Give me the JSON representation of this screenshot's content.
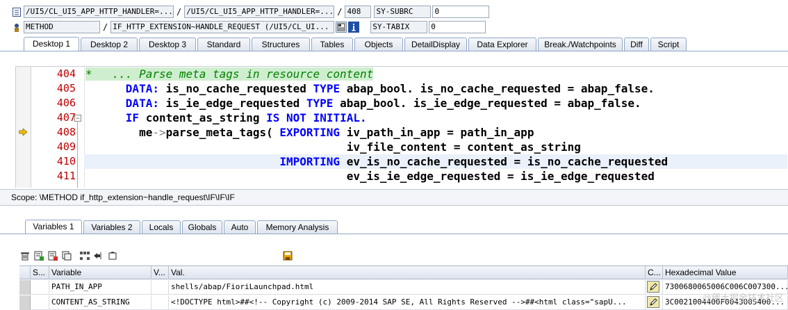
{
  "header": {
    "row1": {
      "program_1": "/UI5/CL_UI5_APP_HTTP_HANDLER=...",
      "program_2": "/UI5/CL_UI5_APP_HTTP_HANDLER=...",
      "line": "408",
      "sys_label": "SY-SUBRC",
      "sys_value": "0"
    },
    "row2": {
      "event_type": "METHOD",
      "event_name": "IF_HTTP_EXTENSION~HANDLE_REQUEST (/UI5/CL_UI...",
      "sys_label": "SY-TABIX",
      "sys_value": "0"
    },
    "icons": {
      "row1": "program-icon",
      "row2": "method-icon",
      "info": "info-icon",
      "doc": "document-icon"
    }
  },
  "desktop_tabs": [
    "Desktop 1",
    "Desktop 2",
    "Desktop 3",
    "Standard",
    "Structures",
    "Tables",
    "Objects",
    "DetailDisplay",
    "Data Explorer",
    "Break./Watchpoints",
    "Diff",
    "Script"
  ],
  "code": {
    "lines": [
      {
        "num": "404",
        "text": "*   ... Parse meta tags in resource content"
      },
      {
        "num": "405",
        "text": "DATA: is_no_cache_requested TYPE abap_bool. is_no_cache_requested = abap_false."
      },
      {
        "num": "406",
        "text": "DATA: is_ie_edge_requested TYPE abap_bool. is_ie_edge_requested = abap_false."
      },
      {
        "num": "407",
        "text": "IF content_as_string IS NOT INITIAL."
      },
      {
        "num": "408",
        "text": "me->parse_meta_tags( EXPORTING iv_path_in_app = path_in_app"
      },
      {
        "num": "409",
        "text": "iv_file_content = content_as_string"
      },
      {
        "num": "410",
        "text": "IMPORTING ev_is_no_cache_requested = is_no_cache_requested"
      },
      {
        "num": "411",
        "text": "ev_is_ie_edge_requested = is_ie_edge_requested"
      }
    ],
    "current_line": "408"
  },
  "scope": "Scope: \\METHOD if_http_extension~handle_request\\IF\\IF\\IF",
  "variable_tabs": [
    "Variables 1",
    "Variables 2",
    "Locals",
    "Globals",
    "Auto",
    "Memory Analysis"
  ],
  "toolbar_icons": [
    "delete-icon",
    "insert-icon",
    "append-icon",
    "copy-icon",
    "hierarchy-icon",
    "navigate-icon",
    "detail-icon",
    "save-icon"
  ],
  "grid": {
    "columns": [
      "S...",
      "Variable",
      "V...",
      "Val.",
      "C...",
      "Hexadecimal Value"
    ],
    "rows": [
      {
        "variable": "PATH_IN_APP",
        "value": "shells/abap/FioriLaunchpad.html",
        "hex": "7300680065006C006C007300..."
      },
      {
        "variable": "CONTENT_AS_STRING",
        "value": "<!DOCTYPE html>##<!-- Copyright (c) 2009-2014 SAP SE, All Rights Reserved -->##<html class=\"sapU...",
        "hex": "3C0021004400F0043005400..."
      }
    ]
  },
  "watermark": "@稀土掘金技术社区",
  "colors": {
    "line_number": "#c00000",
    "keyword": "#0000ff",
    "comment": "#008000",
    "comment_bg": "#cfeecf",
    "tab_border": "#8fa6c4"
  }
}
